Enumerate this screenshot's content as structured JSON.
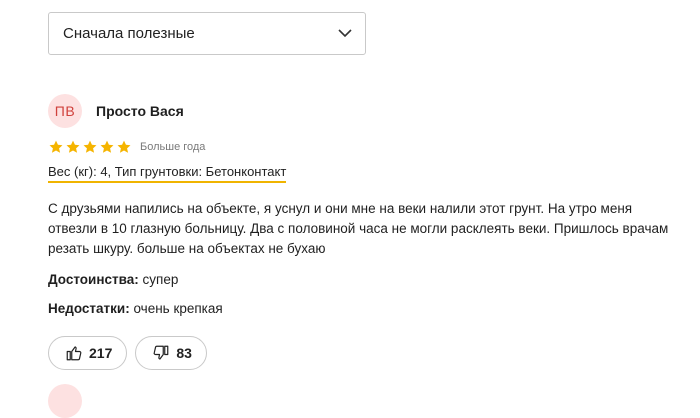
{
  "sort": {
    "selected": "Сначала полезные",
    "icon": "chevron-down-icon"
  },
  "review": {
    "author_initials": "ПВ",
    "author_name": "Просто Вася",
    "rating": 5,
    "rating_max": 5,
    "age": "Больше года",
    "variant": "Вес (кг): 4, Тип грунтовки: Бетонконтакт",
    "text": "С друзьями напились на объекте, я уснул и они мне на веки налили этот грунт. На утро меня отвезли в 10 глазную больницу. Два с половиной часа не могли расклеять веки. Пришлось врачам резать шкуру. больше на объектах не бухаю",
    "pros_label": "Достоинства:",
    "pros_value": "супер",
    "cons_label": "Недостатки:",
    "cons_value": "очень крепкая",
    "likes": "217",
    "dislikes": "83"
  },
  "colors": {
    "star": "#f5b400",
    "avatar_bg": "#fde1e1",
    "avatar_text": "#d0413c",
    "variant_underline": "#f0b400"
  }
}
